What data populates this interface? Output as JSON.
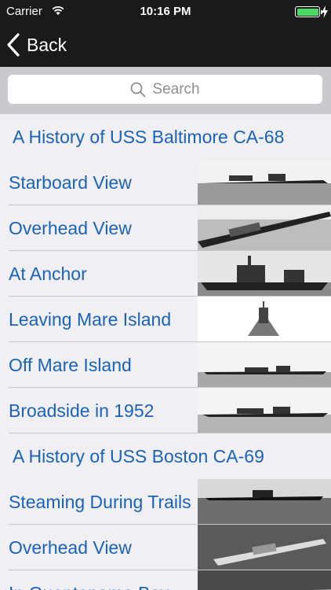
{
  "status": {
    "carrier": "Carrier",
    "time": "10:16 PM",
    "battery_level": 1.0
  },
  "nav": {
    "back_label": "Back"
  },
  "search": {
    "placeholder": "Search"
  },
  "sections": [
    {
      "title": "A History of USS Baltimore CA-68",
      "rows": [
        {
          "label": "Starboard View"
        },
        {
          "label": "Overhead View"
        },
        {
          "label": "At Anchor"
        },
        {
          "label": "Leaving Mare Island"
        },
        {
          "label": "Off Mare Island"
        },
        {
          "label": "Broadside in 1952"
        }
      ]
    },
    {
      "title": "A History of USS Boston CA-69",
      "rows": [
        {
          "label": "Steaming During Trails"
        },
        {
          "label": "Overhead View"
        },
        {
          "label": "In Guantanamo Bay"
        }
      ]
    }
  ],
  "colors": {
    "link": "#1a63b8",
    "background": "#efeff4",
    "bar": "#1a1a1a",
    "battery": "#4cd964"
  }
}
